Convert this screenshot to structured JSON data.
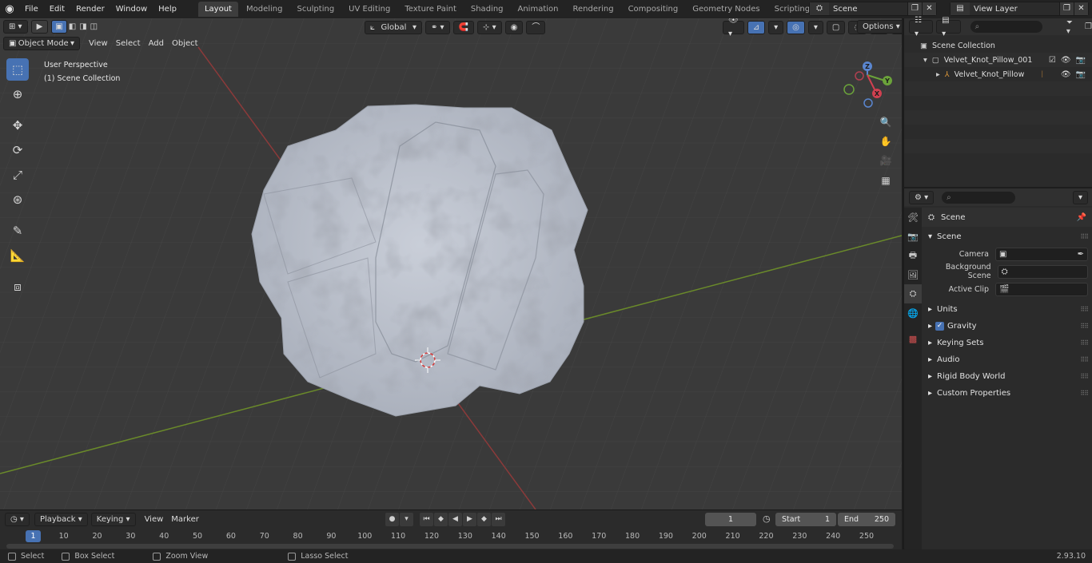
{
  "menu": [
    "File",
    "Edit",
    "Render",
    "Window",
    "Help"
  ],
  "workspaces": [
    {
      "label": "Layout",
      "active": true
    },
    {
      "label": "Modeling",
      "active": false
    },
    {
      "label": "Sculpting",
      "active": false
    },
    {
      "label": "UV Editing",
      "active": false
    },
    {
      "label": "Texture Paint",
      "active": false
    },
    {
      "label": "Shading",
      "active": false
    },
    {
      "label": "Animation",
      "active": false
    },
    {
      "label": "Rendering",
      "active": false
    },
    {
      "label": "Compositing",
      "active": false
    },
    {
      "label": "Geometry Nodes",
      "active": false
    },
    {
      "label": "Scripting",
      "active": false
    }
  ],
  "scene_name": "Scene",
  "view_layer_name": "View Layer",
  "viewport": {
    "mode": "Object Mode",
    "menus": [
      "View",
      "Select",
      "Add",
      "Object"
    ],
    "transform_orientation": "Global",
    "options_label": "Options",
    "perspective_label": "User Perspective",
    "collection_label": "(1) Scene Collection"
  },
  "gizmo": {
    "x": "X",
    "y": "Y",
    "z": "Z"
  },
  "outliner": {
    "root": "Scene Collection",
    "items": [
      {
        "label": "Velvet_Knot_Pillow_001",
        "level": 1
      },
      {
        "label": "Velvet_Knot_Pillow",
        "level": 2
      }
    ]
  },
  "properties": {
    "context": "Scene",
    "panel_title": "Scene",
    "fields": [
      {
        "label": "Camera",
        "value": ""
      },
      {
        "label": "Background Scene",
        "value": ""
      },
      {
        "label": "Active Clip",
        "value": ""
      }
    ],
    "collapsed_panels": [
      "Units",
      "Gravity",
      "Keying Sets",
      "Audio",
      "Rigid Body World",
      "Custom Properties"
    ],
    "gravity_checked": true
  },
  "timeline": {
    "menus": [
      "Playback",
      "Keying",
      "View",
      "Marker"
    ],
    "current_frame": "1",
    "start_label": "Start",
    "start_value": "1",
    "end_label": "End",
    "end_value": "250",
    "ruler_ticks": [
      "1",
      "10",
      "20",
      "30",
      "40",
      "50",
      "60",
      "70",
      "80",
      "90",
      "100",
      "110",
      "120",
      "130",
      "140",
      "150",
      "160",
      "170",
      "180",
      "190",
      "200",
      "210",
      "220",
      "230",
      "240",
      "250"
    ]
  },
  "statusbar": {
    "items": [
      "Select",
      "Box Select",
      "Zoom View",
      "Lasso Select"
    ],
    "version": "2.93.10"
  }
}
